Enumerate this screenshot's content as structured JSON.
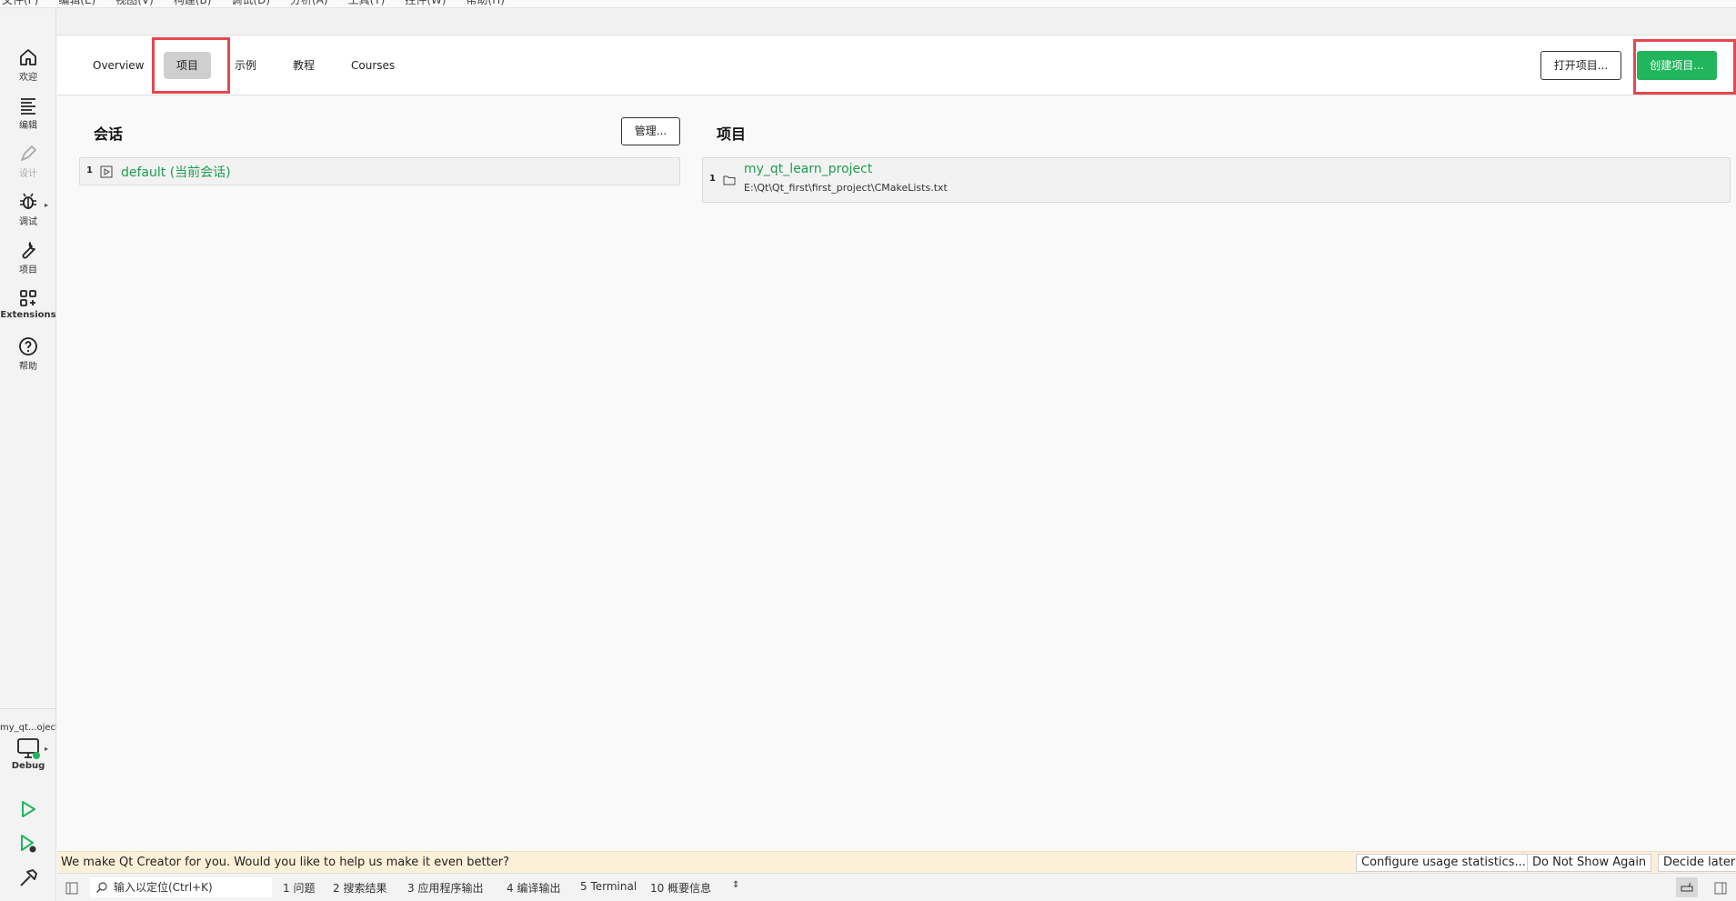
{
  "menubar": [
    "文件(F)",
    "编辑(E)",
    "视图(V)",
    "构建(B)",
    "调试(D)",
    "分析(A)",
    "工具(T)",
    "控件(W)",
    "帮助(H)"
  ],
  "modes": [
    {
      "label": "欢迎",
      "icon": "home-icon"
    },
    {
      "label": "编辑",
      "icon": "edit-lines-icon"
    },
    {
      "label": "设计",
      "icon": "pen-icon"
    },
    {
      "label": "调试",
      "icon": "bug-icon"
    },
    {
      "label": "项目",
      "icon": "wrench-icon"
    },
    {
      "label": "Extensions",
      "icon": "extensions-icon"
    },
    {
      "label": "帮助",
      "icon": "help-icon"
    }
  ],
  "kit": {
    "project": "my_qt...oject",
    "build": "Debug"
  },
  "welcome": {
    "tabs": [
      "Overview",
      "项目",
      "示例",
      "教程",
      "Courses"
    ],
    "active_tab": "项目",
    "open_project": "打开项目...",
    "create_project": "创建项目..."
  },
  "sessions": {
    "title": "会话",
    "manage": "管理...",
    "items": [
      {
        "num": "1",
        "name": "default (当前会话)"
      }
    ]
  },
  "projects": {
    "title": "项目",
    "items": [
      {
        "num": "1",
        "name": "my_qt_learn_project",
        "path": "E:\\Qt\\Qt_first\\first_project\\CMakeLists.txt"
      }
    ]
  },
  "infobar": {
    "message": "We make Qt Creator for you. Would you like to help us make it even better?",
    "configure": "Configure usage statistics...",
    "dont_show": "Do Not Show Again",
    "decide_later": "Decide later"
  },
  "statusbar": {
    "locator_placeholder": "输入以定位(Ctrl+K)",
    "panes": [
      "1 问题",
      "2 搜索结果",
      "3 应用程序输出",
      "4 编译输出",
      "5 Terminal",
      "10 概要信息"
    ]
  },
  "colors": {
    "accent_green": "#21b55c",
    "highlight_red": "#e8474e",
    "link_green": "#1e9d4f"
  }
}
